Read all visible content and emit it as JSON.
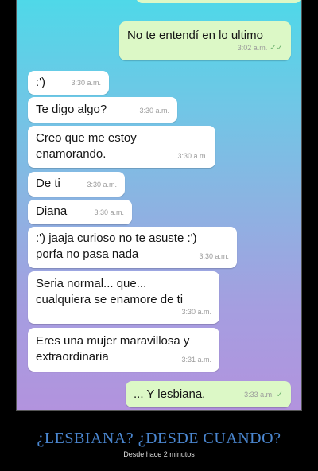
{
  "messages": [
    {
      "text": "No te entendí en lo ultimo",
      "time": "3:02 a.m.",
      "check": "✓✓"
    },
    {
      "text": ":')",
      "time": "3:30 a.m."
    },
    {
      "text": "Te digo algo?",
      "time": "3:30 a.m."
    },
    {
      "text": "Creo que me estoy\nenamorando.",
      "time": "3:30 a.m."
    },
    {
      "text": "De ti",
      "time": "3:30 a.m."
    },
    {
      "text": "Diana",
      "time": "3:30 a.m."
    },
    {
      "text": ":') jaaja curioso no te asuste :')\nporfa no pasa nada",
      "time": "3:30 a.m."
    },
    {
      "text": "Seria normal...  que...\ncualquiera se enamore de ti",
      "time": "3:30 a.m."
    },
    {
      "text": "Eres una mujer maravillosa y\nextraordinaria",
      "time": "3:31 a.m."
    },
    {
      "text": "... Y lesbiana.",
      "time": "3:33 a.m.",
      "check": "✓"
    }
  ],
  "caption": {
    "title": "¿LESBIANA? ¿DESDE CUANDO?",
    "subtitle": "Desde hace 2 minutos"
  }
}
